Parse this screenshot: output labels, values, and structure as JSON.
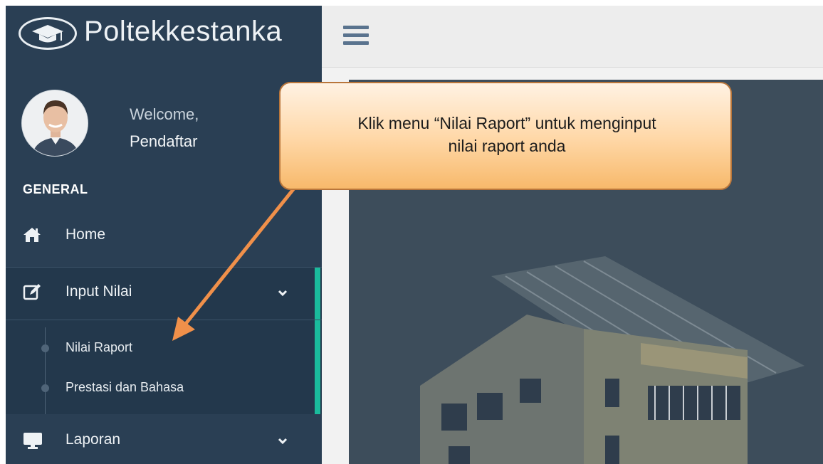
{
  "sidebar": {
    "brand": "Poltekkestanka",
    "welcome": "Welcome,",
    "username": "Pendaftar",
    "section": "GENERAL",
    "items": [
      {
        "label": "Home",
        "icon": "home-icon"
      },
      {
        "label": "Input Nilai",
        "icon": "edit-icon",
        "expanded": true,
        "children": [
          {
            "label": "Nilai Raport"
          },
          {
            "label": "Prestasi dan Bahasa"
          }
        ]
      },
      {
        "label": "Laporan",
        "icon": "monitor-icon"
      }
    ]
  },
  "colors": {
    "sidebar": "#2a3f54",
    "active_indicator": "#1abb9c",
    "callout": "#ffd8a8",
    "arrow": "#f0904a"
  },
  "callout": {
    "line1": "Klik menu “Nilai Raport” untuk menginput",
    "line2": "nilai raport anda"
  }
}
